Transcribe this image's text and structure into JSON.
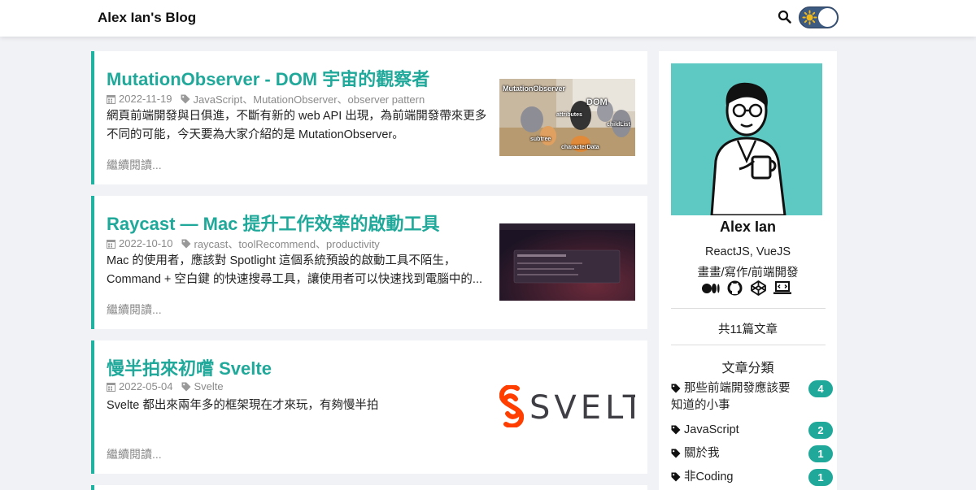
{
  "header": {
    "blog_title": "Alex Ian's Blog"
  },
  "posts": [
    {
      "title": "MutationObserver - DOM 宇宙的觀察者",
      "date": "2022-11-19",
      "tags": "JavaScript、MutationObserver、observer pattern",
      "excerpt": "網頁前端開發與日俱進，不斷有新的 web API 出現，為前端開發帶來更多不同的可能，今天要為大家介紹的是 MutationObserver。",
      "read_more": "繼續閱讀...",
      "thumb_labels": [
        "MutationObserver",
        "DOM",
        "attributes",
        "childList",
        "subtree",
        "characterData"
      ]
    },
    {
      "title": "Raycast — Mac 提升工作效率的啟動工具",
      "date": "2022-10-10",
      "tags": "raycast、toolRecommend、productivity",
      "excerpt": "Mac 的使用者，應該對 Spotlight 這個系統預設的啟動工具不陌生，Command + 空白鍵 的快速搜尋工具，讓使用者可以快速找到電腦中的...",
      "read_more": "繼續閱讀..."
    },
    {
      "title": "慢半拍來初嚐 Svelte",
      "date": "2022-05-04",
      "tags": "Svelte",
      "excerpt": "Svelte 都出來兩年多的框架現在才來玩，有夠慢半拍",
      "read_more": "繼續閱讀...",
      "thumb_text": "SVELT"
    }
  ],
  "sidebar": {
    "author_name": "Alex Ian",
    "skills": "ReactJS, VueJS",
    "hobbies": "畫畫/寫作/前端開發",
    "socials": [
      "medium-icon",
      "github-icon",
      "codepen-icon",
      "laptop-code-icon"
    ],
    "post_count": "共11篇文章",
    "categories_heading": "文章分類",
    "categories": [
      {
        "label": "那些前端開發應該要知道的小事",
        "count": "4"
      },
      {
        "label": "JavaScript",
        "count": "2"
      },
      {
        "label": "關於我",
        "count": "1"
      },
      {
        "label": "非Coding",
        "count": "1"
      }
    ]
  },
  "colors": {
    "accent": "#20a99a",
    "avatar_bg": "#5ec8c2",
    "toggle": "#3d5a80"
  }
}
